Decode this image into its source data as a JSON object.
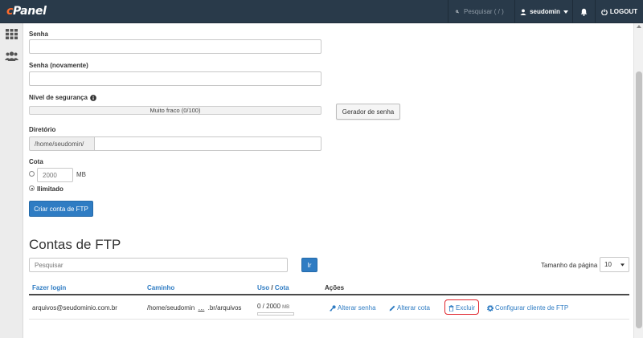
{
  "header": {
    "logo": "cPanel",
    "search_placeholder": "Pesquisar ( / )",
    "username": "seudomin",
    "logout_label": "LOGOUT"
  },
  "colors": {
    "header_bg": "#293a4a",
    "logo_accent": "#ff6c2c",
    "primary": "#2f7cc3",
    "highlight": "#e0232b",
    "strength_low": "#d9534f"
  },
  "sidebar": {
    "icons": [
      "grid-icon",
      "users-icon"
    ]
  },
  "form": {
    "password_label": "Senha",
    "password_value": "",
    "password_confirm_label": "Senha (novamente)",
    "password_confirm_value": "",
    "strength_label": "Nível de segurança",
    "strength_text": "Muito fraco (0/100)",
    "strength_value": 0,
    "generator_button": "Gerador de senha",
    "directory_label": "Diretório",
    "directory_prefix": "/home/seudomin/",
    "directory_value": "",
    "quota_label": "Cota",
    "quota_placeholder": "2000",
    "quota_unit": "MB",
    "unlimited_label": "Ilimitado",
    "unlimited_selected": true,
    "create_button": "Criar conta de FTP"
  },
  "accounts": {
    "title": "Contas de FTP",
    "search_placeholder": "Pesquisar",
    "go_button": "Ir",
    "page_size_label": "Tamanho da página",
    "page_size_value": "10",
    "columns": {
      "login": "Fazer login",
      "path": "Caminho",
      "usage": "Uso",
      "separator": "/",
      "quota": "Cota",
      "actions": "Ações"
    },
    "rows": [
      {
        "login": "arquivos@seudominio.com.br",
        "path_start": "/home/seudomin",
        "path_gap": "…",
        "path_end": ".br/arquivos",
        "usage": "0 / 2000",
        "usage_unit": "MB",
        "usage_fraction": 0,
        "actions": {
          "change_password": "Alterar senha",
          "change_quota": "Alterar cota",
          "delete": "Excluir",
          "configure_client": "Configurar cliente de FTP"
        }
      }
    ]
  }
}
